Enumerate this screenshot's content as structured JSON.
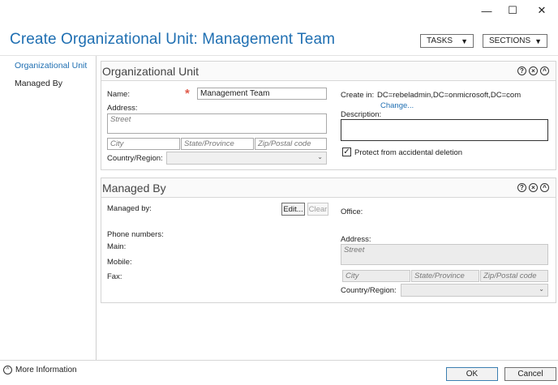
{
  "window": {
    "minimize_glyph": "—",
    "maximize_glyph": "☐",
    "close_glyph": "✕"
  },
  "header": {
    "title": "Create Organizational Unit: Management Team",
    "tasks_label": "TASKS",
    "sections_label": "SECTIONS",
    "dropdown_glyph": "▼"
  },
  "nav": {
    "items": [
      {
        "label": "Organizational Unit",
        "active": true
      },
      {
        "label": "Managed By",
        "active": false
      }
    ]
  },
  "section_ou": {
    "title": "Organizational Unit",
    "name_label": "Name:",
    "required_marker": "*",
    "name_value": "Management Team",
    "address_label": "Address:",
    "street_placeholder": "Street",
    "city_placeholder": "City",
    "state_placeholder": "State/Province",
    "zip_placeholder": "Zip/Postal code",
    "country_label": "Country/Region:",
    "create_in_label": "Create in:",
    "create_in_value": "DC=rebeladmin,DC=onmicrosoft,DC=com",
    "change_link": "Change...",
    "description_label": "Description:",
    "description_value": "",
    "protect_label": "Protect from accidental deletion",
    "protect_checked": true,
    "check_glyph": "✓"
  },
  "section_managed": {
    "title": "Managed By",
    "managed_by_label": "Managed by:",
    "edit_button": "Edit...",
    "clear_button": "Clear",
    "phone_numbers_label": "Phone numbers:",
    "main_label": "Main:",
    "mobile_label": "Mobile:",
    "fax_label": "Fax:",
    "office_label": "Office:",
    "address_label": "Address:",
    "street_placeholder": "Street",
    "city_placeholder": "City",
    "state_placeholder": "State/Province",
    "zip_placeholder": "Zip/Postal code",
    "country_label": "Country/Region:"
  },
  "section_icons": {
    "help": "?",
    "close": "×",
    "collapse": "^"
  },
  "footer": {
    "more_info_label": "More Information",
    "more_info_glyph": "^",
    "ok_label": "OK",
    "cancel_label": "Cancel"
  },
  "colors": {
    "accent": "#1f6fb2",
    "required": "#e05a4a"
  }
}
